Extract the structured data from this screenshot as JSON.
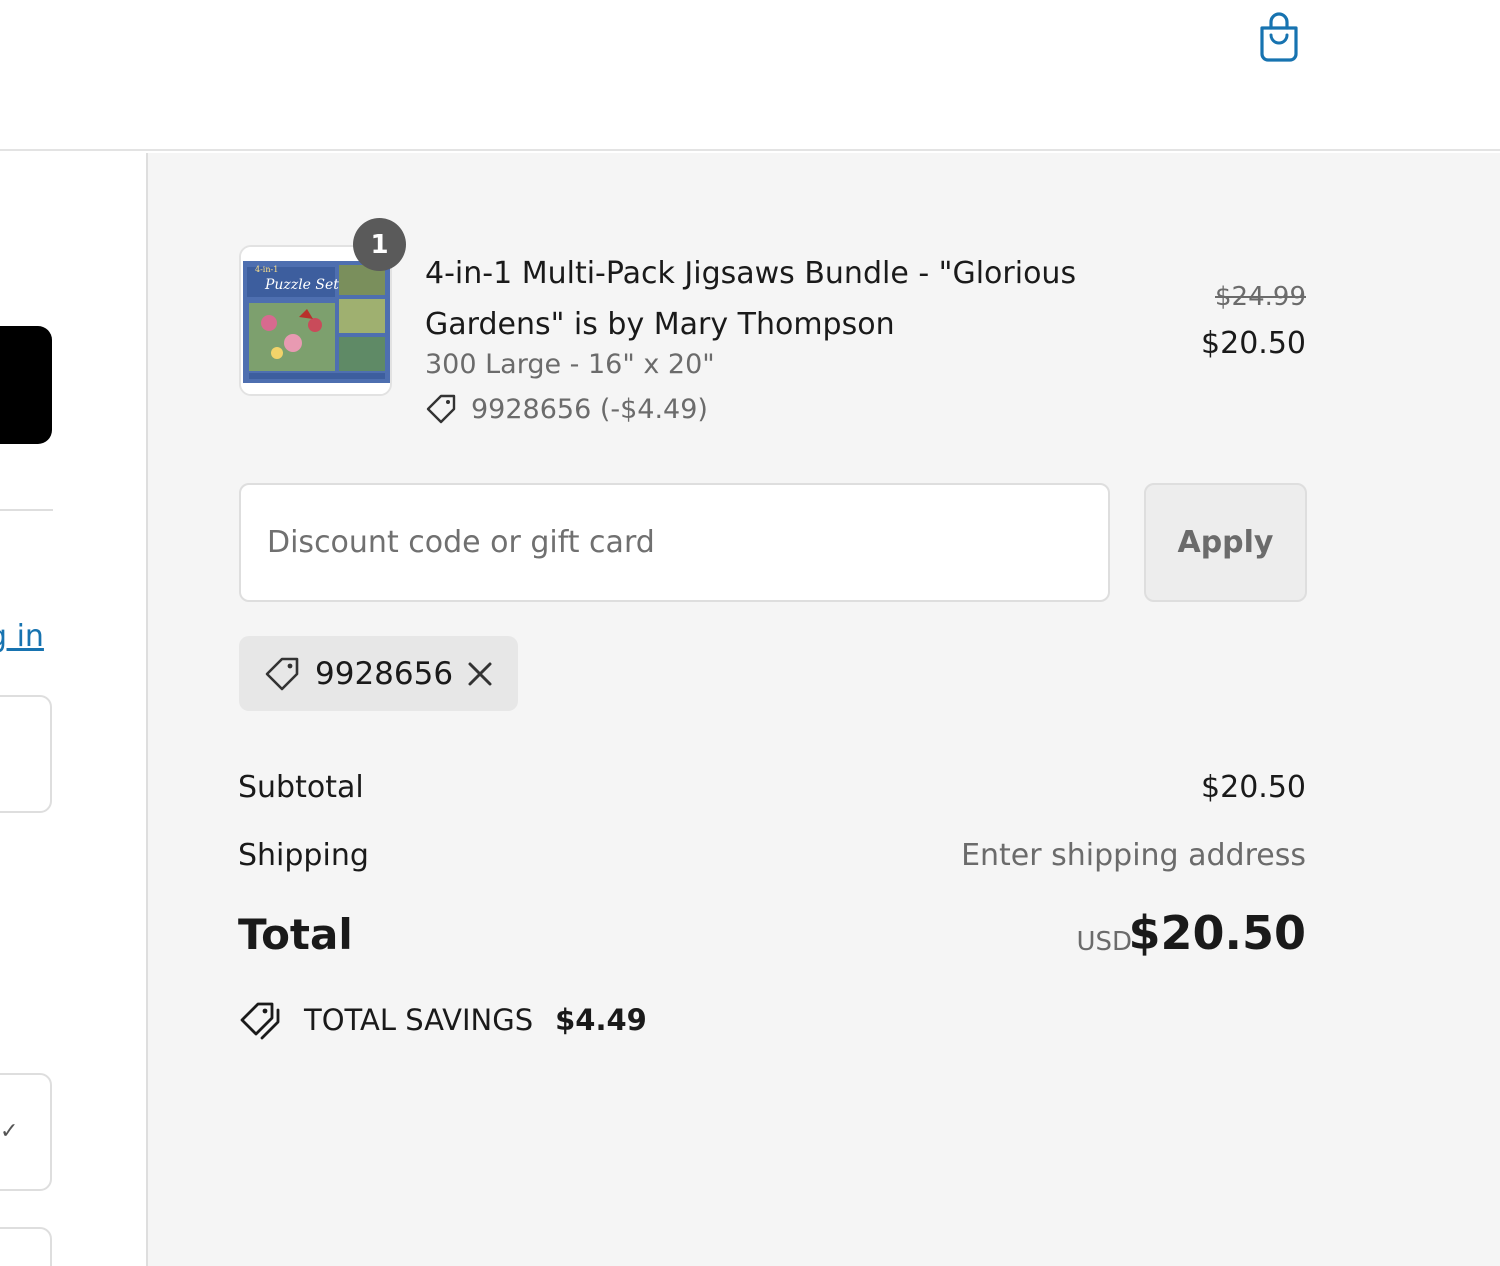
{
  "header": {
    "cart_icon": "shopping-bag-icon",
    "accent_color": "#1773b0"
  },
  "left": {
    "login_link_fragment": "g in",
    "check_icon": "checkmark-icon"
  },
  "order_summary": {
    "line_item": {
      "quantity": "1",
      "title": "4-in-1 Multi-Pack Jigsaws Bundle - \"Glorious Gardens\" is by Mary Thompson",
      "variant": "300 Large - 16\" x 20\"",
      "discount_label": "9928656 (-$4.49)",
      "original_price": "$24.99",
      "price": "$20.50",
      "thumbnail_text": "Puzzle Set",
      "thumbnail_prefix": "4-in-1"
    },
    "discount": {
      "placeholder": "Discount code or gift card",
      "apply_label": "Apply",
      "applied_code": "9928656"
    },
    "totals": {
      "subtotal_label": "Subtotal",
      "subtotal_value": "$20.50",
      "shipping_label": "Shipping",
      "shipping_value": "Enter shipping address",
      "total_label": "Total",
      "currency": "USD",
      "total_value": "$20.50",
      "savings_label": "TOTAL SAVINGS",
      "savings_value": "$4.49"
    }
  }
}
